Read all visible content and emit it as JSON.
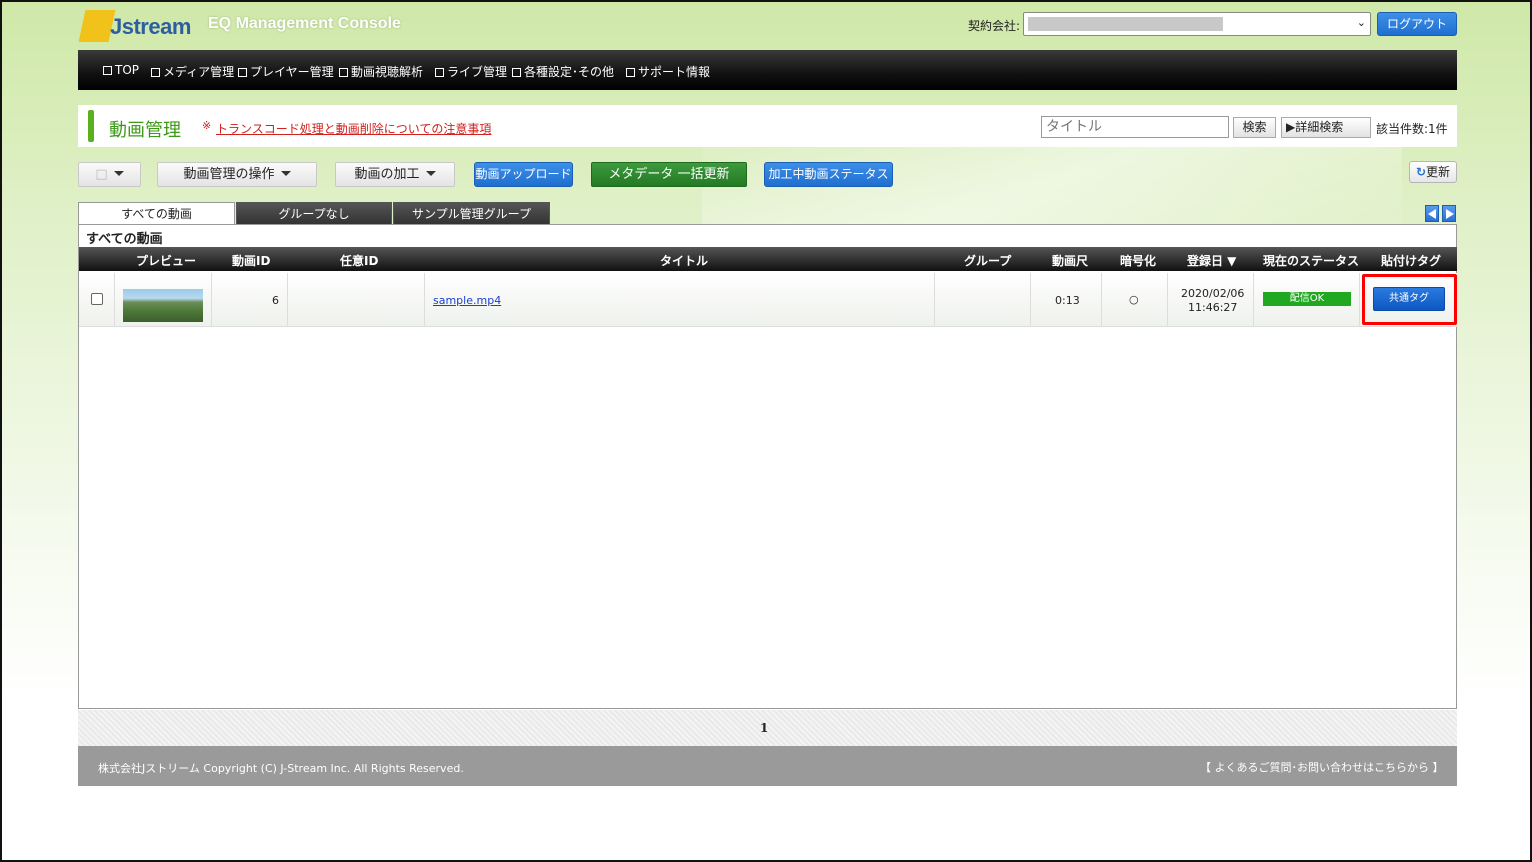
{
  "header": {
    "logo_text": "Jstream",
    "console_title": "EQ Management Console",
    "company_label": "契約会社:",
    "logout_label": "ログアウト"
  },
  "nav": {
    "items": [
      "TOP",
      "メディア管理",
      "プレイヤー管理",
      "動画視聴解析",
      "ライブ管理",
      "各種設定･その他",
      "サポート情報"
    ]
  },
  "titlebar": {
    "title": "動画管理",
    "notice_mark": "※",
    "notice_link": "トランスコード処理と動画削除についての注意事項",
    "search_placeholder": "タイトル",
    "search_label": "検索",
    "advanced_search_label": "▶詳細検索",
    "result_count": "該当件数:1件"
  },
  "toolbar": {
    "select_symbol": "□",
    "manage_ops_label": "動画管理の操作",
    "processing_label": "動画の加工",
    "upload_label": "動画アップロード",
    "metadata_label": "メタデータ 一括更新",
    "processing_status_label": "加工中動画ステータス",
    "refresh_label": "更新"
  },
  "tabs": [
    "すべての動画",
    "グループなし",
    "サンプル管理グループ"
  ],
  "section_title": "すべての動画",
  "table": {
    "headers": [
      "プレビュー",
      "動画ID",
      "任意ID",
      "タイトル",
      "グループ",
      "動画尺",
      "暗号化",
      "登録日 ▼",
      "現在のステータス",
      "貼付けタグ"
    ],
    "rows": [
      {
        "video_id": "6",
        "custom_id": "",
        "title": "sample.mp4",
        "group": "",
        "duration": "0:13",
        "encrypted": "○",
        "date": "2020/02/06",
        "time": "11:46:27",
        "status": "配信OK",
        "tag_button": "共通タグ"
      }
    ]
  },
  "pager": {
    "current": "1"
  },
  "footer": {
    "copyright": "株式会社Jストリーム  Copyright (C) J-Stream Inc. All Rights Reserved.",
    "faq": "【 よくあるご質問･お問い合わせはこちらから 】"
  },
  "colors": {
    "accent_green": "#3c9a17",
    "button_blue": "#1f6fd0",
    "status_green": "#21a821",
    "highlight_red": "#ff0000"
  }
}
